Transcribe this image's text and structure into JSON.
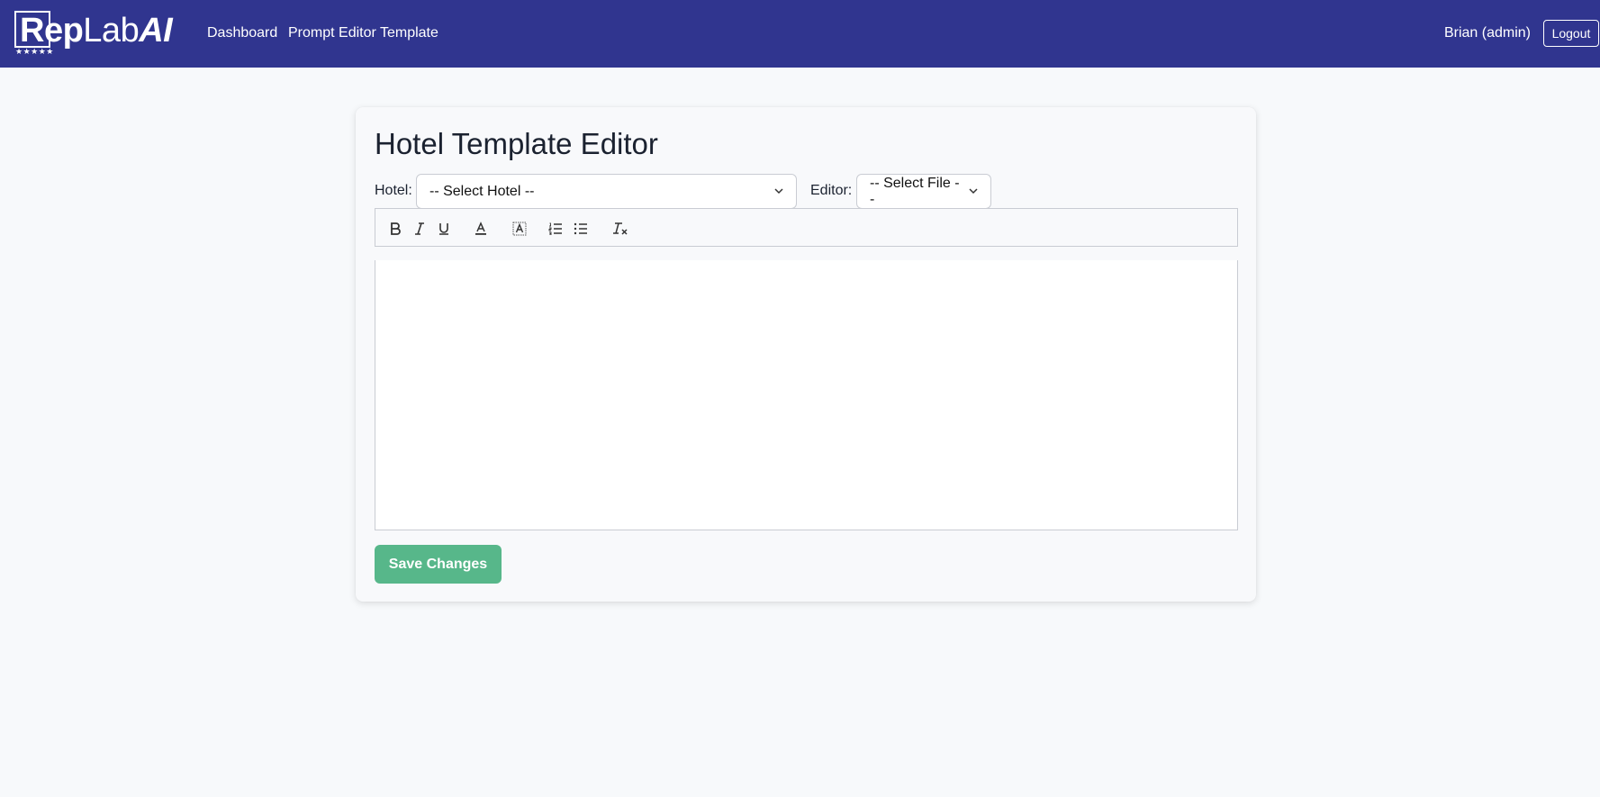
{
  "brand": {
    "logo_part1": "Rep",
    "logo_part2": "Lab",
    "logo_part3": "AI",
    "logo_stars": "★★★★★"
  },
  "nav": {
    "items": [
      {
        "label": "Dashboard"
      },
      {
        "label": "Prompt Editor Template"
      }
    ]
  },
  "user": {
    "name": "Brian (admin)",
    "logout_label": "Logout"
  },
  "page": {
    "title": "Hotel Template Editor",
    "hotel_label": "Hotel:",
    "hotel_selected": "-- Select Hotel --",
    "editor_label": "Editor:",
    "file_selected": "-- Select File --",
    "save_label": "Save Changes"
  },
  "toolbar": {
    "tools": [
      {
        "icon": "bold-icon"
      },
      {
        "icon": "italic-icon"
      },
      {
        "icon": "underline-icon"
      },
      {
        "icon": "text-color-icon"
      },
      {
        "icon": "highlight-icon"
      },
      {
        "icon": "ordered-list-icon"
      },
      {
        "icon": "bullet-list-icon"
      },
      {
        "icon": "clear-format-icon"
      }
    ]
  },
  "colors": {
    "header_bg": "#30358f",
    "save_button": "#57b78a",
    "page_bg": "#f7f9fb"
  }
}
